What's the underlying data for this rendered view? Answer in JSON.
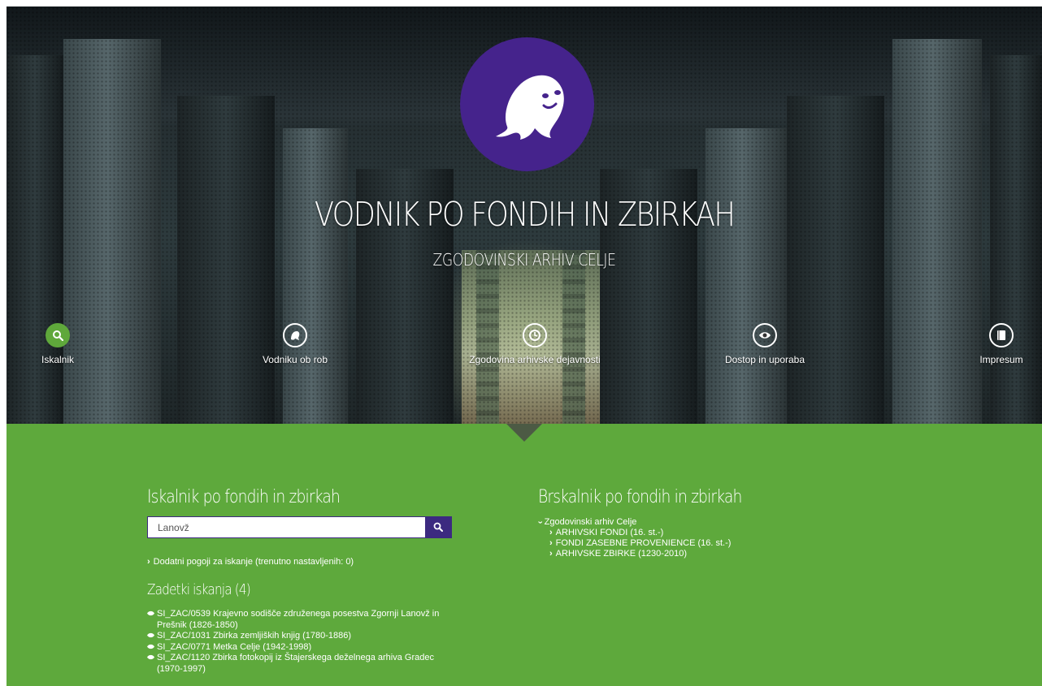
{
  "hero": {
    "title": "VODNIK PO FONDIH IN ZBIRKAH",
    "subtitle": "ZGODOVINSKI ARHIV CELJE",
    "logo_color": "#45238c",
    "nav": [
      {
        "label": "Iskalnik",
        "icon": "search-icon",
        "active": true
      },
      {
        "label": "Vodniku ob rob",
        "icon": "ghost-icon",
        "active": false
      },
      {
        "label": "Zgodovina arhivske dejavnosti",
        "icon": "clock-icon",
        "active": false
      },
      {
        "label": "Dostop in uporaba",
        "icon": "eye-icon",
        "active": false
      },
      {
        "label": "Impresum",
        "icon": "book-icon",
        "active": false
      }
    ]
  },
  "search": {
    "heading": "Iskalnik po fondih in zbirkah",
    "value": "Lanovž",
    "button_icon": "search-icon",
    "extra_conditions": "Dodatni pogoji za iskanje (trenutno nastavljenih: 0)",
    "results_heading": "Zadetki iskanja (4)",
    "results": [
      "SI_ZAC/0539 Krajevno sodišče združenega posestva Zgornji Lanovž in Prešnik (1826-1850)",
      "SI_ZAC/1031 Zbirka zemljiških knjig (1780-1886)",
      "SI_ZAC/0771 Metka Celje (1942-1998)",
      "SI_ZAC/1120 Zbirka fotokopij iz Štajerskega deželnega arhiva Gradec (1970-1997)"
    ]
  },
  "browse": {
    "heading": "Brskalnik po fondih in zbirkah",
    "root": "Zgodovinski arhiv Celje",
    "children": [
      "ARHIVSKI FONDI (16. st.-)",
      "FONDI ZASEBNE PROVENIENCE (16. st.-)",
      "ARHIVSKE ZBIRKE (1230-2010)"
    ]
  },
  "colors": {
    "green": "#5ea93c",
    "purple": "#3c2a80",
    "active_nav": "#5fa83b"
  }
}
